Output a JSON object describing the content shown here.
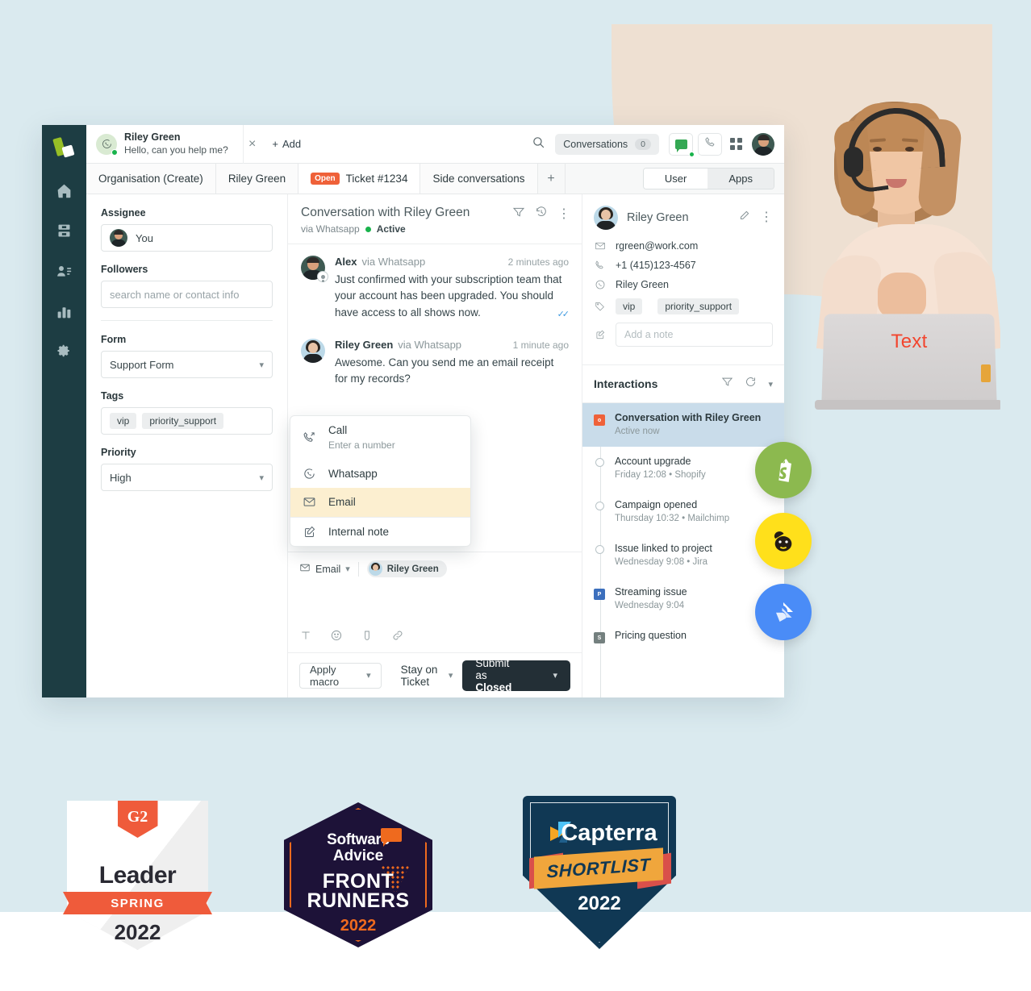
{
  "hero": {
    "laptop_text": "Text",
    "accent_red": "#f2452e",
    "beige": "#eee0d2",
    "page_background": "#daeaef"
  },
  "app": {
    "rail": {
      "logo_name": "app-logo",
      "items": [
        {
          "name": "home-icon",
          "label": "Home"
        },
        {
          "name": "inbox-icon",
          "label": "Inbox"
        },
        {
          "name": "contacts-icon",
          "label": "Contacts"
        },
        {
          "name": "analytics-icon",
          "label": "Analytics"
        },
        {
          "name": "settings-icon",
          "label": "Settings"
        }
      ]
    },
    "topbar": {
      "ticket_tab": {
        "name": "Riley Green",
        "preview": "Hello, can you help me?",
        "channel_icon": "whatsapp-icon",
        "close_label": "×",
        "online": true
      },
      "add_tab_label": "Add",
      "search_icon": "search-icon",
      "conversations_label": "Conversations",
      "conversations_count": "0",
      "chat_status_icon": "chat-icon",
      "phone_icon": "phone-icon",
      "apps_grid_icon": "grid-icon",
      "avatar_name": "user-avatar"
    },
    "breadcrumbs": {
      "items": [
        {
          "label": "Organisation (Create)",
          "badge": null
        },
        {
          "label": "Riley Green",
          "badge": null
        },
        {
          "label": "Ticket #1234",
          "badge": "Open"
        },
        {
          "label": "Side conversations",
          "badge": null
        }
      ],
      "add_label": "+",
      "segments": [
        {
          "label": "User",
          "selected": true
        },
        {
          "label": "Apps",
          "selected": false
        }
      ]
    },
    "properties": {
      "assignee_label": "Assignee",
      "assignee_value": "You",
      "followers_label": "Followers",
      "followers_placeholder": "search name or contact info",
      "form_label": "Form",
      "form_value": "Support Form",
      "tags_label": "Tags",
      "tags": [
        "vip",
        "priority_support"
      ],
      "priority_label": "Priority",
      "priority_value": "High"
    },
    "conversation": {
      "title": "Conversation with Riley Green",
      "via": "via Whatsapp",
      "status": "Active",
      "filter_icon": "filter-icon",
      "history_icon": "history-icon",
      "more_icon": "more-vertical-icon",
      "messages": [
        {
          "author": "Alex",
          "via": "via Whatsapp",
          "time": "2 minutes ago",
          "text": "Just confirmed with your subscription team that your account has been upgraded. You should have access to all shows now.",
          "read_receipt": true,
          "is_agent": true
        },
        {
          "author": "Riley Green",
          "via": "via Whatsapp",
          "time": "1 minute ago",
          "text": "Awesome. Can you send me an email receipt for my records?",
          "read_receipt": false,
          "is_agent": false
        }
      ]
    },
    "channel_menu": {
      "items": [
        {
          "icon": "phone-outgoing-icon",
          "label": "Call",
          "sub": "Enter a number",
          "highlighted": false
        },
        {
          "icon": "whatsapp-icon",
          "label": "Whatsapp",
          "sub": null,
          "highlighted": false
        },
        {
          "icon": "envelope-icon",
          "label": "Email",
          "sub": null,
          "highlighted": true
        },
        {
          "icon": "note-edit-icon",
          "label": "Internal note",
          "sub": null,
          "highlighted": false
        }
      ]
    },
    "composer": {
      "channel_label": "Email",
      "recipient": "Riley Green",
      "tools": [
        "text-format-icon",
        "emoji-icon",
        "attachment-icon",
        "link-icon"
      ]
    },
    "footer": {
      "macro_label": "Apply macro",
      "stay_label": "Stay on Ticket",
      "submit_prefix": "Submit as ",
      "submit_state": "Closed"
    },
    "contact": {
      "name": "Riley Green",
      "edit_icon": "pencil-icon",
      "more_icon": "more-vertical-icon",
      "email": "rgreen@work.com",
      "phone": "+1 (415)123-4567",
      "whatsapp": "Riley Green",
      "tags": [
        "vip",
        "priority_support"
      ],
      "note_placeholder": "Add a note"
    },
    "interactions": {
      "title": "Interactions",
      "filter_icon": "filter-icon",
      "refresh_icon": "refresh-icon",
      "collapse_icon": "chevron-down-icon",
      "items": [
        {
          "title": "Conversation with Riley Green",
          "sub": "Active now",
          "marker": "square-orange",
          "marker_letter": "o",
          "active": true
        },
        {
          "title": "Account upgrade",
          "sub": "Friday 12:08 • Shopify",
          "marker": "ring",
          "marker_letter": "",
          "active": false
        },
        {
          "title": "Campaign opened",
          "sub": "Thursday 10:32 • Mailchimp",
          "marker": "ring",
          "marker_letter": "",
          "active": false
        },
        {
          "title": "Issue linked to project",
          "sub": "Wednesday 9:08 • Jira",
          "marker": "ring",
          "marker_letter": "",
          "active": false
        },
        {
          "title": "Streaming issue",
          "sub": "Wednesday 9:04",
          "marker": "square-blue",
          "marker_letter": "P",
          "active": false
        },
        {
          "title": "Pricing question",
          "sub": "",
          "marker": "square-grey",
          "marker_letter": "S",
          "active": false
        }
      ]
    },
    "integration_bubbles": [
      {
        "name": "shopify-logo",
        "color": "#8cb94f"
      },
      {
        "name": "mailchimp-logo",
        "color": "#ffe01b"
      },
      {
        "name": "jira-logo",
        "color": "#4a8cf7"
      }
    ]
  },
  "awards": {
    "g2": {
      "brand": "G2",
      "title": "Leader",
      "ribbon": "SPRING",
      "year": "2022"
    },
    "software_advice": {
      "brand_line1": "Software",
      "brand_line2": "Advice",
      "title_line1": "FRONT",
      "title_line2": "RUNNERS",
      "year": "2022"
    },
    "capterra": {
      "brand": "Capterra",
      "ribbon": "SHORTLIST",
      "year": "2022"
    }
  }
}
